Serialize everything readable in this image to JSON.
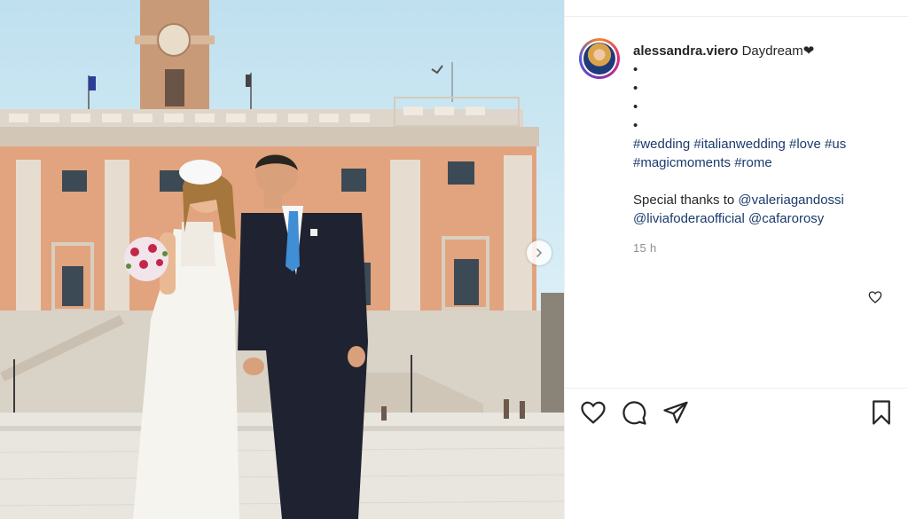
{
  "post": {
    "username": "alessandra.viero",
    "caption_first": "Daydream",
    "caption_heart": "❤",
    "dots": [
      "•",
      "•",
      "•",
      "•"
    ],
    "hashtags_line1": [
      "#wedding",
      "#italianwedding",
      "#love",
      "#us"
    ],
    "hashtags_line2": [
      "#magicmoments",
      "#rome"
    ],
    "thanks_text": "Special thanks to",
    "mentions": [
      "@valeriagandossi",
      "@liviafoderaofficial",
      "@cafarorosy"
    ],
    "timestamp": "15 h"
  },
  "icons": {
    "next": "chevron-right-icon",
    "comment_like": "heart-outline-icon",
    "like": "heart-icon",
    "comment": "speech-bubble-icon",
    "share": "paper-plane-icon",
    "save": "bookmark-icon"
  },
  "colors": {
    "text": "#262626",
    "link": "#1a3b6e",
    "muted": "#8e8e8e",
    "border": "#efefef"
  }
}
